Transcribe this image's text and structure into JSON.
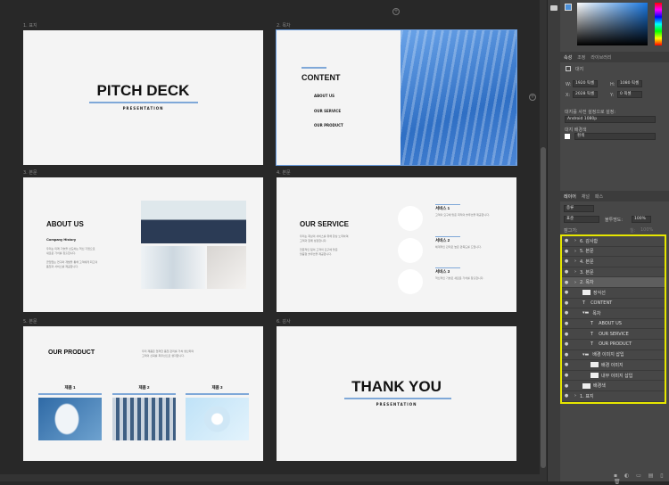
{
  "artboards": [
    {
      "label": "1. 표지",
      "title": "PITCH DECK",
      "subtitle": "PRESENTATION"
    },
    {
      "label": "2. 목차",
      "title": "CONTENT",
      "items": [
        "ABOUT US",
        "OUR SERVICE",
        "OUR PRODUCT"
      ]
    },
    {
      "label": "3. 본문",
      "title": "ABOUT US",
      "heading": "Company History",
      "para1": [
        "우리는 미래 기술을 선도하는 혁신 기업으로",
        "새로운 가치를 창출합니다."
      ],
      "para2": [
        "끊임없는 연구와 개발을 통해 고객에게 최고의",
        "품질과 서비스를 제공합니다."
      ]
    },
    {
      "label": "4. 본문",
      "title": "OUR SERVICE",
      "para1": [
        "우리는 최상의 서비스를 위해 항상 노력하며",
        "고객과 함께 성장합니다."
      ],
      "para2": [
        "전문적인 팀이 고객의 요구에 맞춘",
        "맞춤형 솔루션을 제공합니다."
      ],
      "services": [
        {
          "name": "서비스 1",
          "desc": "고객의 요구에 맞춘 최적의 솔루션을 제공합니다."
        },
        {
          "name": "서비스 2",
          "desc": "체계적인 관리로 높은 만족도를 드립니다."
        },
        {
          "name": "서비스 3",
          "desc": "혁신적인 기술로 새로운 가치를 창출합니다."
        }
      ]
    },
    {
      "label": "5. 본문",
      "title": "OUR PRODUCT",
      "desc": [
        "우리 제품은 엄격한 품질 관리를 거쳐 생산되며",
        "고객의 신뢰를 최우선으로 생각합니다."
      ],
      "products": [
        "제품 1",
        "제품 2",
        "제품 3"
      ]
    },
    {
      "label": "6. 감사",
      "title": "THANK YOU",
      "subtitle": "PRESENTATION"
    }
  ],
  "properties": {
    "tabs": [
      "속성",
      "조정",
      "라이브러리"
    ],
    "type": "대지",
    "w_label": "W:",
    "w": "1920 픽셀",
    "h_label": "H:",
    "h": "1080 픽셀",
    "x_label": "X:",
    "x": "2028 픽셀",
    "y_label": "Y:",
    "y": "0 픽셀",
    "preset_label": "대지를 사전 설정으로 설정:",
    "preset": "Android 1080p",
    "bg_label": "대지 배경색",
    "bg": "흰색"
  },
  "layers_panel": {
    "tabs": [
      "레이어",
      "채널",
      "패스"
    ],
    "filter": "종류",
    "blend": "표준",
    "opacity_label": "불투명도:",
    "opacity": "100%",
    "lock_label": "잠그기:",
    "fill_label": "칠:",
    "fill": "100%"
  },
  "layers": [
    {
      "name": "6. 감사함",
      "indent": 0,
      "icon": "group"
    },
    {
      "name": "5. 본문",
      "indent": 0,
      "icon": "group"
    },
    {
      "name": "4. 본문",
      "indent": 0,
      "icon": "group"
    },
    {
      "name": "3. 본문",
      "indent": 0,
      "icon": "group"
    },
    {
      "name": "2. 목차",
      "indent": 0,
      "icon": "group",
      "selected": true
    },
    {
      "name": "장식선",
      "indent": 1,
      "icon": "thumb"
    },
    {
      "name": "CONTENT",
      "indent": 1,
      "icon": "text"
    },
    {
      "name": "목차",
      "indent": 1,
      "icon": "folder"
    },
    {
      "name": "ABOUT US",
      "indent": 2,
      "icon": "text"
    },
    {
      "name": "OUR SERVICE",
      "indent": 2,
      "icon": "text"
    },
    {
      "name": "OUR PRODUCT",
      "indent": 2,
      "icon": "text"
    },
    {
      "name": "배경 이미지 삽입",
      "indent": 1,
      "icon": "folder"
    },
    {
      "name": "배경 이미지",
      "indent": 2,
      "icon": "thumb"
    },
    {
      "name": "내부 이미지 삽입",
      "indent": 2,
      "icon": "thumb"
    },
    {
      "name": "배경색",
      "indent": 1,
      "icon": "thumb"
    },
    {
      "name": "1. 표지",
      "indent": 0,
      "icon": "group"
    }
  ],
  "colors": {
    "accent": "#7fa8d8",
    "highlight": "#e6e600"
  }
}
